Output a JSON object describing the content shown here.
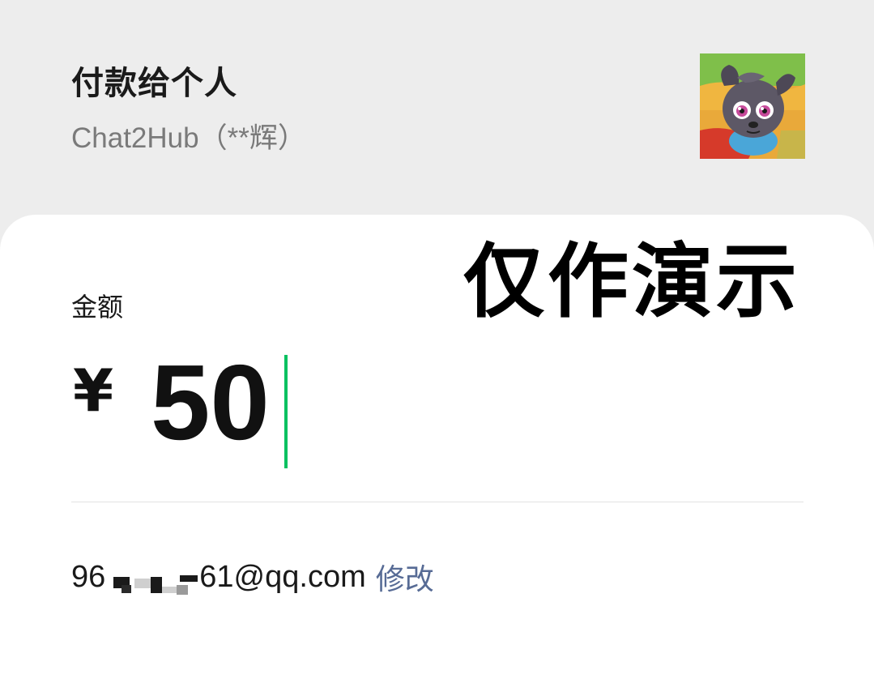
{
  "header": {
    "title": "付款给个人",
    "subtitle": "Chat2Hub（**辉）",
    "avatar_icon": "cartoon-dog-avatar"
  },
  "overlay": {
    "watermark": "仅作演示"
  },
  "payment": {
    "amount_label": "金额",
    "currency_symbol": "¥",
    "amount": "50"
  },
  "email": {
    "prefix": "96",
    "suffix": "61@qq.com",
    "edit_label": "修改"
  },
  "colors": {
    "background": "#ededed",
    "card": "#ffffff",
    "caret": "#07c160",
    "link": "#576b95"
  }
}
